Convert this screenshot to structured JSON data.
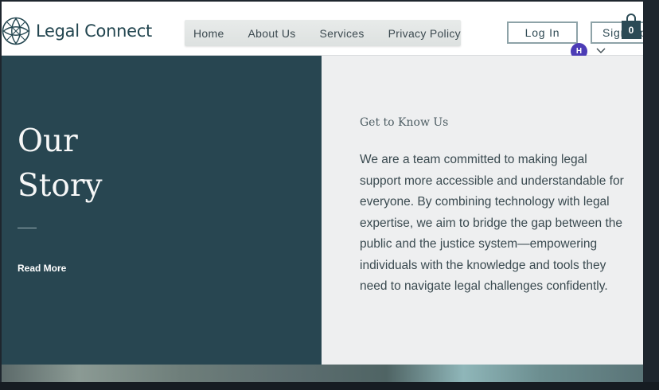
{
  "brand": {
    "name": "Legal Connect",
    "logo_icon": "knot-logo-icon"
  },
  "nav": {
    "items": [
      "Home",
      "About Us",
      "Services",
      "Privacy Policy"
    ]
  },
  "auth": {
    "login_label": "Log In",
    "signup_label": "Sign Up"
  },
  "cart": {
    "count": "0",
    "icon": "shopping-bag-icon"
  },
  "user": {
    "avatar_initial": "H"
  },
  "hero": {
    "title_line1": "Our",
    "title_line2": "Story",
    "read_more_label": "Read More",
    "eyebrow": "Get to Know Us",
    "body": "We are a team committed to making legal support more accessible and understandable for everyone. By combining technology with legal expertise, we aim to bridge the gap between the public and the justice system—empowering individuals with the knowledge and tools they need to navigate legal challenges confidently."
  },
  "colors": {
    "panel_dark": "#284651",
    "brand_text": "#234650",
    "avatar": "#4c3cb6",
    "cart": "#2b4a55"
  }
}
